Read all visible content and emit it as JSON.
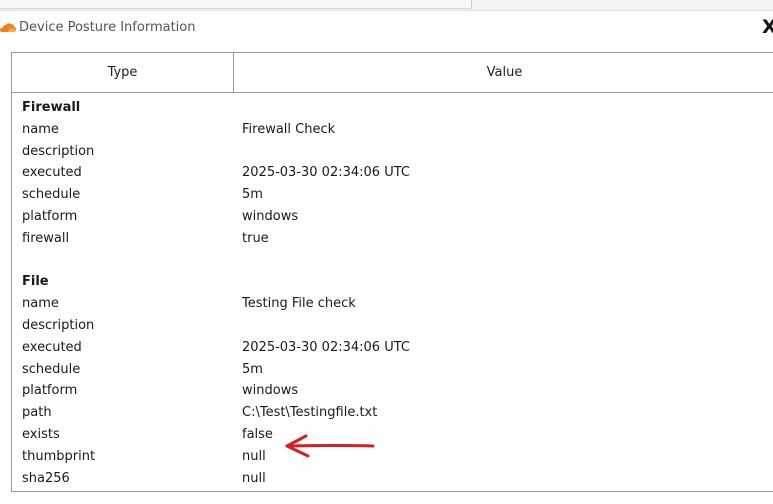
{
  "window": {
    "title": "Device Posture Information",
    "close_glyph": "X",
    "icon": "cloudflare-cloud-icon",
    "icon_color": "#f38020"
  },
  "table": {
    "headers": {
      "type": "Type",
      "value": "Value"
    },
    "sections": [
      {
        "name": "Firewall",
        "rows": [
          {
            "type": "name",
            "value": "Firewall Check"
          },
          {
            "type": "description",
            "value": ""
          },
          {
            "type": "executed",
            "value": "2025-03-30 02:34:06 UTC"
          },
          {
            "type": "schedule",
            "value": "5m"
          },
          {
            "type": "platform",
            "value": "windows"
          },
          {
            "type": "firewall",
            "value": "true"
          }
        ]
      },
      {
        "name": "File",
        "rows": [
          {
            "type": "name",
            "value": "Testing File check"
          },
          {
            "type": "description",
            "value": ""
          },
          {
            "type": "executed",
            "value": "2025-03-30 02:34:06 UTC"
          },
          {
            "type": "schedule",
            "value": "5m"
          },
          {
            "type": "platform",
            "value": "windows"
          },
          {
            "type": "path",
            "value": "C:\\Test\\Testingfile.txt"
          },
          {
            "type": "exists",
            "value": "false"
          },
          {
            "type": "thumbprint",
            "value": "null"
          },
          {
            "type": "sha256",
            "value": "null"
          }
        ]
      }
    ]
  },
  "annotation": {
    "type": "arrow",
    "color": "#d42020"
  }
}
